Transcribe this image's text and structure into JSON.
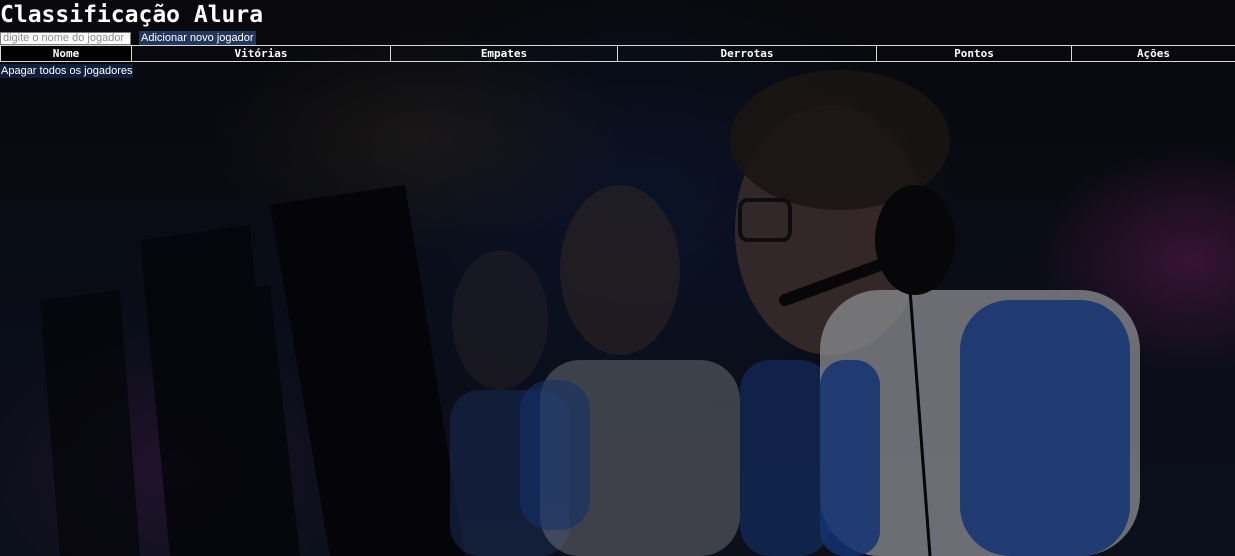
{
  "header": {
    "title": "Classificação Alura"
  },
  "form": {
    "input_placeholder": "digite o nome do jogador",
    "input_value": "",
    "add_button_label": "Adicionar novo jogador"
  },
  "table": {
    "columns": [
      "Nome",
      "Vitórias",
      "Empates",
      "Derrotas",
      "Pontos",
      "Ações"
    ],
    "rows": []
  },
  "actions": {
    "clear_button_label": "Apagar todos os jogadores"
  },
  "background": {
    "description_icon": "gaming-room-background-image"
  }
}
